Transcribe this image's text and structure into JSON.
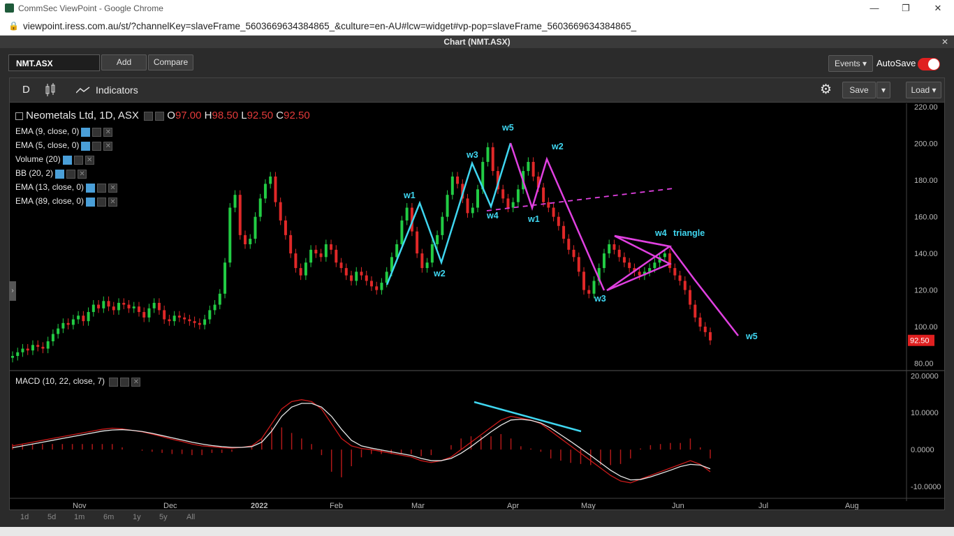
{
  "browser": {
    "title": "CommSec ViewPoint - Google Chrome",
    "url": "viewpoint.iress.com.au/st/?channelKey=slaveFrame_5603669634384865_&culture=en-AU#lcw=widget#vp-pop=slaveFrame_5603669634384865_",
    "minimize": "—",
    "restore": "❐",
    "close": "✕"
  },
  "window": {
    "title": "Chart (NMT.ASX)",
    "close": "✕"
  },
  "controls": {
    "symbol": "NMT.ASX",
    "add": "Add",
    "compare": "Compare",
    "events": "Events ▾",
    "autosave": "AutoSave"
  },
  "toolbar": {
    "interval": "D",
    "indicators": "Indicators",
    "save": "Save",
    "load": "Load ▾",
    "save_arrow": "▾"
  },
  "legend": {
    "name": "Neometals Ltd, 1D, ASX",
    "o_label": "O",
    "o_val": "97.00",
    "h_label": "H",
    "h_val": "98.50",
    "l_label": "L",
    "l_val": "92.50",
    "c_label": "C",
    "c_val": "92.50",
    "indicators": [
      "EMA (9, close, 0)",
      "EMA (5, close, 0)",
      "Volume (20)",
      "BB (20, 2)",
      "EMA (13, close, 0)",
      "EMA (89, close, 0)"
    ],
    "macd": "MACD (10, 22, close, 7)"
  },
  "chart_data": {
    "type": "candlestick",
    "price_axis": [
      "220.00",
      "200.00",
      "180.00",
      "160.00",
      "140.00",
      "120.00",
      "100.00",
      "80.00"
    ],
    "price_ylim": [
      76,
      222
    ],
    "last_price": "92.50",
    "macd_axis": [
      "20.0000",
      "10.0000",
      "0.0000",
      "-10.0000"
    ],
    "macd_ylim": [
      -13,
      21
    ],
    "x_labels": [
      "Nov",
      "Dec",
      "2022",
      "Feb",
      "Mar",
      "Apr",
      "May",
      "Jun",
      "Jul",
      "Aug"
    ],
    "annotations": [
      "w1",
      "w2",
      "w3",
      "w4",
      "w5",
      "w1",
      "w2",
      "w3",
      "w4",
      "triangle",
      "w5"
    ],
    "closes": [
      84,
      86,
      88,
      87,
      90,
      89,
      88,
      92,
      96,
      99,
      102,
      101,
      104,
      106,
      103,
      108,
      112,
      110,
      114,
      111,
      109,
      113,
      112,
      110,
      111,
      108,
      105,
      110,
      113,
      109,
      104,
      103,
      106,
      105,
      104,
      103,
      102,
      101,
      104,
      109,
      112,
      118,
      135,
      165,
      172,
      150,
      145,
      148,
      160,
      170,
      178,
      182,
      168,
      158,
      150,
      140,
      132,
      128,
      135,
      142,
      140,
      138,
      145,
      142,
      135,
      132,
      128,
      125,
      130,
      128,
      125,
      122,
      120,
      124,
      130,
      138,
      145,
      158,
      165,
      152,
      140,
      132,
      135,
      145,
      150,
      160,
      172,
      182,
      178,
      170,
      162,
      165,
      175,
      190,
      198,
      185,
      175,
      170,
      165,
      168,
      175,
      185,
      190,
      182,
      176,
      168,
      165,
      160,
      155,
      148,
      142,
      138,
      130,
      120,
      118,
      125,
      132,
      140,
      145,
      142,
      138,
      135,
      132,
      130,
      128,
      130,
      132,
      135,
      138,
      140,
      132,
      128,
      125,
      120,
      112,
      105,
      100,
      97,
      92.5
    ],
    "macd_line": [
      1,
      1.5,
      2,
      2.5,
      3,
      3.5,
      4,
      4.5,
      5,
      5.5,
      5.8,
      5.6,
      5.2,
      4.8,
      4.2,
      3.5,
      2.8,
      2.2,
      1.5,
      1,
      0.8,
      0.5,
      0.4,
      0.6,
      1,
      3,
      7,
      11,
      13,
      13.5,
      13,
      11,
      7,
      3,
      1,
      0.3,
      0,
      -0.5,
      -1,
      -1.5,
      -2,
      -3,
      -3.5,
      -3,
      -2,
      0,
      2,
      4,
      6,
      8,
      9,
      8.5,
      8,
      7,
      5,
      3,
      1,
      -1,
      -3,
      -5,
      -7,
      -8.5,
      -9,
      -8,
      -7,
      -6,
      -5,
      -4,
      -3,
      -4,
      -6
    ],
    "signal_line": [
      0.5,
      1,
      1.5,
      2,
      2.5,
      3,
      3.5,
      4,
      4.5,
      5,
      5.3,
      5.4,
      5.2,
      4.9,
      4.4,
      3.8,
      3.2,
      2.6,
      2,
      1.5,
      1.1,
      0.8,
      0.6,
      0.6,
      0.8,
      2,
      5,
      9,
      11.5,
      12.5,
      12.5,
      11.5,
      9,
      5.5,
      2.5,
      1,
      0.4,
      -0.1,
      -0.6,
      -1.1,
      -1.6,
      -2.4,
      -3,
      -3,
      -2.4,
      -1,
      0.8,
      2.8,
      4.8,
      6.6,
      8,
      8.2,
      7.9,
      7.2,
      5.8,
      4,
      2.2,
      0.3,
      -1.6,
      -3.6,
      -5.6,
      -7.2,
      -8.2,
      -8.1,
      -7.4,
      -6.5,
      -5.6,
      -4.6,
      -4,
      -4.2,
      -5.2
    ]
  }
}
